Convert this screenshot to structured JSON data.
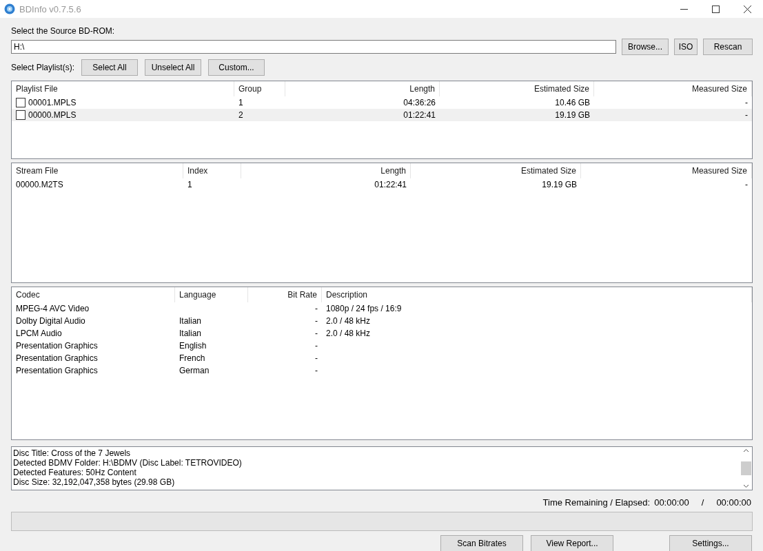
{
  "window": {
    "title": "BDInfo v0.7.5.6"
  },
  "source": {
    "label": "Select the Source BD-ROM:",
    "value": "H:\\",
    "buttons": [
      "Browse...",
      "ISO",
      "Rescan"
    ]
  },
  "playlist_bar": {
    "label": "Select Playlist(s):",
    "buttons": [
      "Select All",
      "Unselect All",
      "Custom..."
    ]
  },
  "playlists": {
    "columns": [
      "Playlist File",
      "Group",
      "Length",
      "Estimated Size",
      "Measured Size"
    ],
    "rows": [
      {
        "cells": [
          "00001.MPLS",
          "1",
          "04:36:26",
          "10.46 GB",
          "-"
        ],
        "checked": false,
        "selected": false
      },
      {
        "cells": [
          "00000.MPLS",
          "2",
          "01:22:41",
          "19.19 GB",
          "-"
        ],
        "checked": false,
        "selected": true
      }
    ]
  },
  "streams": {
    "columns": [
      "Stream File",
      "Index",
      "Length",
      "Estimated Size",
      "Measured Size"
    ],
    "rows": [
      {
        "cells": [
          "00000.M2TS",
          "1",
          "01:22:41",
          "19.19 GB",
          "-"
        ]
      }
    ]
  },
  "codecs": {
    "columns": [
      "Codec",
      "Language",
      "Bit Rate",
      "Description"
    ],
    "rows": [
      {
        "cells": [
          "MPEG-4 AVC Video",
          "",
          "-",
          "1080p / 24 fps / 16:9"
        ]
      },
      {
        "cells": [
          "Dolby Digital Audio",
          "Italian",
          "-",
          "2.0 / 48 kHz"
        ]
      },
      {
        "cells": [
          "LPCM Audio",
          "Italian",
          "-",
          "2.0 / 48 kHz"
        ]
      },
      {
        "cells": [
          "Presentation Graphics",
          "English",
          "-",
          ""
        ]
      },
      {
        "cells": [
          "Presentation Graphics",
          "French",
          "-",
          ""
        ]
      },
      {
        "cells": [
          "Presentation Graphics",
          "German",
          "-",
          ""
        ]
      }
    ]
  },
  "disc_info": [
    "Disc Title: Cross of the 7 Jewels",
    "Detected BDMV Folder: H:\\BDMV (Disc Label: TETROVIDEO)",
    "Detected Features: 50Hz Content",
    "Disc Size: 32,192,047,358 bytes (29.98 GB)"
  ],
  "timer": {
    "label": "Time Remaining / Elapsed:",
    "remaining": "00:00:00",
    "separator": "/",
    "elapsed": "00:00:00"
  },
  "progress": {
    "level": 0
  },
  "footer_buttons": [
    "Scan Bitrates",
    "View Report...",
    "Settings..."
  ]
}
